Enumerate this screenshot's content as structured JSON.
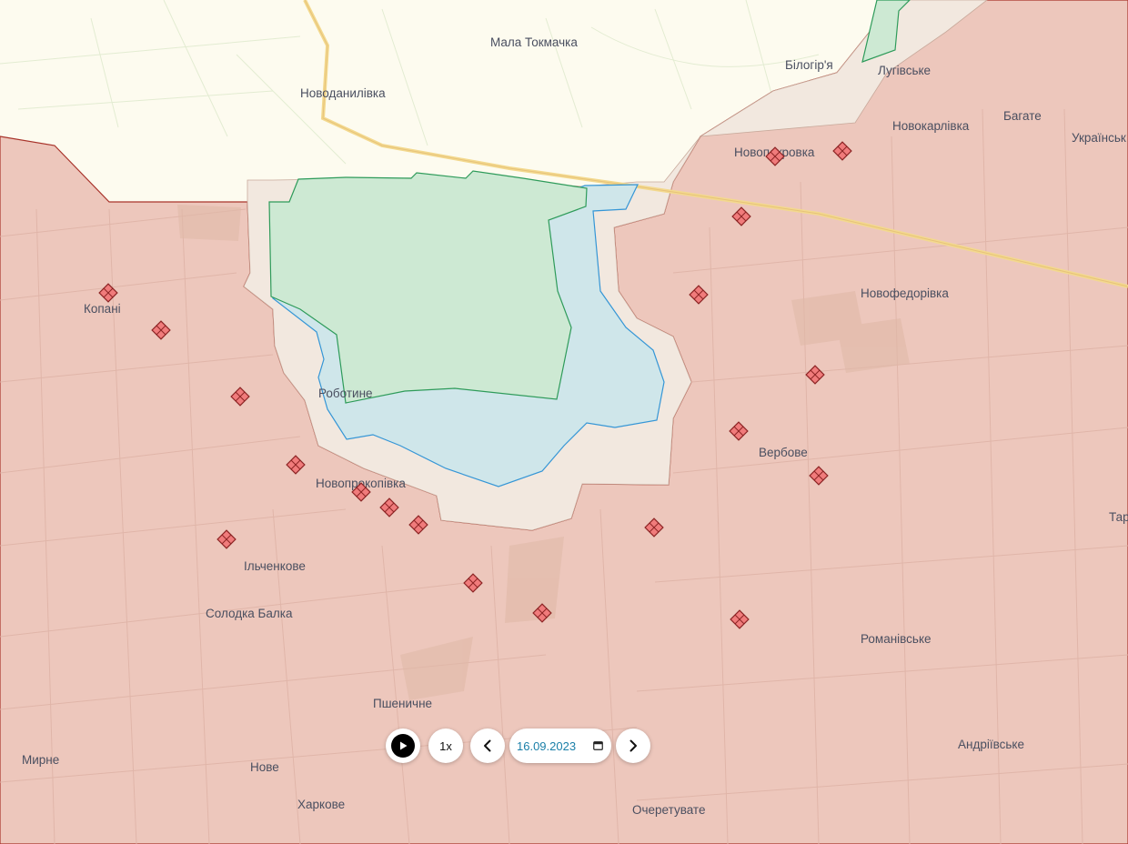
{
  "map": {
    "colors": {
      "background": "#fdfbef",
      "occupied_fill": "#edc7bc",
      "occupied_border": "#a8332a",
      "grey_zone_fill": "#f2e8df",
      "liberated_fill": "#cde9d3",
      "liberated_border": "#2e9b5a",
      "blue_fill": "#cfe6ea",
      "blue_border": "#3596d6",
      "road": "#f3d98e",
      "marker_fill": "#f07b7b",
      "marker_stroke": "#8c2424"
    },
    "settlements": [
      "Мала Токмачка",
      "Білогір'я",
      "Лугівське",
      "Новоданилівка",
      "Новокарлівка",
      "Багате",
      "Українськ",
      "Новопокровка",
      "Копані",
      "Новофедорівка",
      "Роботине",
      "Вербове",
      "Новопрокопівка",
      "Тар",
      "Ільченкове",
      "Солодка Балка",
      "Романівське",
      "Пшеничне",
      "Андріївське",
      "Мирне",
      "Нове",
      "Харкове",
      "Очеретувате"
    ],
    "marker_icon": "fortification-icon"
  },
  "controls": {
    "play_icon": "play-icon",
    "speed_label": "1x",
    "prev_icon": "chevron-left-icon",
    "date_value": "16.09.2023",
    "calendar_icon": "calendar-icon",
    "next_icon": "chevron-right-icon"
  }
}
